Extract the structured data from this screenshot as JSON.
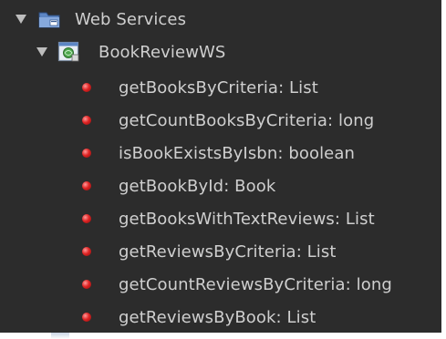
{
  "tree": {
    "root": {
      "label": "Web Services",
      "icon": "folder-icon",
      "expanded": true
    },
    "service": {
      "label": "BookReviewWS",
      "icon": "web-service-icon",
      "expanded": true
    },
    "methods": [
      {
        "label": "getBooksByCriteria: List"
      },
      {
        "label": "getCountBooksByCriteria: long"
      },
      {
        "label": "isBookExistsByIsbn: boolean"
      },
      {
        "label": "getBookById: Book"
      },
      {
        "label": "getBooksWithTextReviews: List"
      },
      {
        "label": "getReviewsByCriteria: List"
      },
      {
        "label": "getCountReviewsByCriteria: long"
      },
      {
        "label": "getReviewsByBook: List"
      }
    ],
    "colors": {
      "background": "#2c2c2c",
      "text": "#cfcfcf",
      "method_icon": "#e02424"
    }
  }
}
